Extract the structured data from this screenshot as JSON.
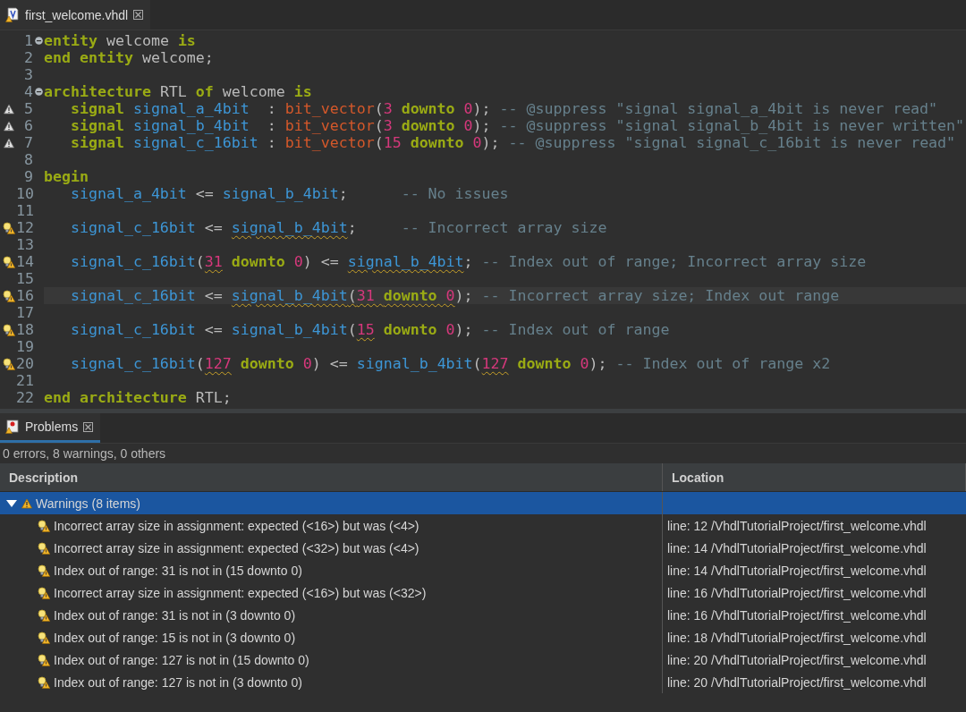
{
  "editor": {
    "tab": {
      "label": "first_welcome.vhdl",
      "selected": true
    },
    "lines": [
      {
        "n": "1",
        "fold": true,
        "tokens": [
          {
            "kind": "keyword",
            "t": "entity"
          },
          {
            "kind": "plain",
            "t": " welcome "
          },
          {
            "kind": "keyword",
            "t": "is"
          }
        ]
      },
      {
        "n": "2",
        "tokens": [
          {
            "kind": "keyword",
            "t": "end "
          },
          {
            "kind": "keyword",
            "t": "entity"
          },
          {
            "kind": "plain",
            "t": " welcome;"
          }
        ]
      },
      {
        "n": "3"
      },
      {
        "n": "4",
        "fold": true,
        "tokens": [
          {
            "kind": "keyword",
            "t": "architecture"
          },
          {
            "kind": "plain",
            "t": " RTL "
          },
          {
            "kind": "keyword",
            "t": "of"
          },
          {
            "kind": "plain",
            "t": " welcome "
          },
          {
            "kind": "keyword",
            "t": "is"
          }
        ]
      },
      {
        "n": "5",
        "marker": {
          "kind": "warning"
        },
        "tokens": [
          {
            "kind": "keyword",
            "t": "   signal "
          },
          {
            "kind": "signal",
            "t": "signal_a_4bit"
          },
          {
            "kind": "plain",
            "t": "  : "
          },
          {
            "kind": "type",
            "t": "bit_vector"
          },
          {
            "kind": "plain",
            "t": "("
          },
          {
            "kind": "number",
            "t": "3 "
          },
          {
            "kind": "keyword",
            "t": "downto "
          },
          {
            "kind": "number",
            "t": "0"
          },
          {
            "kind": "plain",
            "t": "); "
          },
          {
            "kind": "comment",
            "t": "-- @suppress \"signal signal_a_4bit is never read\""
          }
        ]
      },
      {
        "n": "6",
        "marker": {
          "kind": "warning"
        },
        "tokens": [
          {
            "kind": "keyword",
            "t": "   signal "
          },
          {
            "kind": "signal",
            "t": "signal_b_4bit"
          },
          {
            "kind": "plain",
            "t": "  : "
          },
          {
            "kind": "type",
            "t": "bit_vector"
          },
          {
            "kind": "plain",
            "t": "("
          },
          {
            "kind": "number",
            "t": "3 "
          },
          {
            "kind": "keyword",
            "t": "downto "
          },
          {
            "kind": "number",
            "t": "0"
          },
          {
            "kind": "plain",
            "t": "); "
          },
          {
            "kind": "comment",
            "t": "-- @suppress \"signal signal_b_4bit is never written\""
          }
        ]
      },
      {
        "n": "7",
        "marker": {
          "kind": "warning"
        },
        "tokens": [
          {
            "kind": "keyword",
            "t": "   signal "
          },
          {
            "kind": "signal",
            "t": "signal_c_16bit"
          },
          {
            "kind": "plain",
            "t": " : "
          },
          {
            "kind": "type",
            "t": "bit_vector"
          },
          {
            "kind": "plain",
            "t": "("
          },
          {
            "kind": "number",
            "t": "15 "
          },
          {
            "kind": "keyword",
            "t": "downto "
          },
          {
            "kind": "number",
            "t": "0"
          },
          {
            "kind": "plain",
            "t": "); "
          },
          {
            "kind": "comment",
            "t": "-- @suppress \"signal signal_c_16bit is never read\""
          }
        ]
      },
      {
        "n": "8"
      },
      {
        "n": "9",
        "tokens": [
          {
            "kind": "keyword",
            "t": "begin"
          }
        ]
      },
      {
        "n": "10",
        "tokens": [
          {
            "kind": "signal",
            "t": "   signal_a_4bit"
          },
          {
            "kind": "plain",
            "t": " <= "
          },
          {
            "kind": "signal",
            "t": "signal_b_4bit"
          },
          {
            "kind": "plain",
            "t": ";      "
          },
          {
            "kind": "comment",
            "t": "-- No issues"
          }
        ]
      },
      {
        "n": "11"
      },
      {
        "n": "12",
        "marker": {
          "kind": "quickfix"
        },
        "tokens": [
          {
            "kind": "signal",
            "t": "   signal_c_16bit"
          },
          {
            "kind": "plain",
            "t": " <= "
          },
          {
            "kind": "signal",
            "t": "signal_b_4bit",
            "flagged": true
          },
          {
            "kind": "plain",
            "t": ";     "
          },
          {
            "kind": "comment",
            "t": "-- Incorrect array size"
          }
        ]
      },
      {
        "n": "13"
      },
      {
        "n": "14",
        "marker": {
          "kind": "quickfix"
        },
        "tokens": [
          {
            "kind": "signal",
            "t": "   signal_c_16bit"
          },
          {
            "kind": "plain",
            "t": "("
          },
          {
            "kind": "number",
            "t": "31",
            "flagged": true
          },
          {
            "kind": "keyword",
            "t": " downto "
          },
          {
            "kind": "number",
            "t": "0"
          },
          {
            "kind": "plain",
            "t": ") <= "
          },
          {
            "kind": "signal",
            "t": "signal_b_4bit",
            "flagged": true
          },
          {
            "kind": "plain",
            "t": "; "
          },
          {
            "kind": "comment",
            "t": "-- Index out of range; Incorrect array size"
          }
        ]
      },
      {
        "n": "15"
      },
      {
        "n": "16",
        "marker": {
          "kind": "quickfix"
        },
        "current": true,
        "tokens": [
          {
            "kind": "signal",
            "t": "   signal_c_16bit"
          },
          {
            "kind": "plain",
            "t": " <= "
          },
          {
            "kind": "signal",
            "t": "signal_b_4bit",
            "flagged": true
          },
          {
            "kind": "plain",
            "t": "(",
            "flagged": true
          },
          {
            "kind": "number",
            "t": "31 ",
            "flagged": true
          },
          {
            "kind": "keyword",
            "t": "downto ",
            "flagged": true
          },
          {
            "kind": "number",
            "t": "0",
            "flagged": true
          },
          {
            "kind": "plain",
            "t": "); "
          },
          {
            "kind": "comment",
            "t": "-- Incorrect array size; Index out range"
          }
        ]
      },
      {
        "n": "17"
      },
      {
        "n": "18",
        "marker": {
          "kind": "quickfix"
        },
        "tokens": [
          {
            "kind": "signal",
            "t": "   signal_c_16bit"
          },
          {
            "kind": "plain",
            "t": " <= "
          },
          {
            "kind": "signal",
            "t": "signal_b_4bit"
          },
          {
            "kind": "plain",
            "t": "("
          },
          {
            "kind": "number",
            "t": "15",
            "flagged": true
          },
          {
            "kind": "keyword",
            "t": " downto "
          },
          {
            "kind": "number",
            "t": "0"
          },
          {
            "kind": "plain",
            "t": "); "
          },
          {
            "kind": "comment",
            "t": "-- Index out of range"
          }
        ]
      },
      {
        "n": "19"
      },
      {
        "n": "20",
        "marker": {
          "kind": "quickfix"
        },
        "tokens": [
          {
            "kind": "signal",
            "t": "   signal_c_16bit"
          },
          {
            "kind": "plain",
            "t": "("
          },
          {
            "kind": "number",
            "t": "127",
            "flagged": true
          },
          {
            "kind": "keyword",
            "t": " downto "
          },
          {
            "kind": "number",
            "t": "0"
          },
          {
            "kind": "plain",
            "t": ") <= "
          },
          {
            "kind": "signal",
            "t": "signal_b_4bit"
          },
          {
            "kind": "plain",
            "t": "("
          },
          {
            "kind": "number",
            "t": "127",
            "flagged": true
          },
          {
            "kind": "keyword",
            "t": " downto "
          },
          {
            "kind": "number",
            "t": "0"
          },
          {
            "kind": "plain",
            "t": "); "
          },
          {
            "kind": "comment",
            "t": "-- Index out of range x2"
          }
        ]
      },
      {
        "n": "21"
      },
      {
        "n": "22",
        "tokens": [
          {
            "kind": "keyword",
            "t": "end architecture"
          },
          {
            "kind": "plain",
            "t": " RTL;"
          }
        ]
      }
    ]
  },
  "problems": {
    "tab": {
      "label": "Problems",
      "selected": true
    },
    "summary": "0 errors, 8 warnings, 0 others",
    "columns": [
      "Description",
      "Location"
    ],
    "group": {
      "label": "Warnings (8 items)",
      "expanded": true,
      "selected": true
    },
    "rows": [
      {
        "description": "Incorrect array size in assignment: expected (<16>) but was (<4>)",
        "location": "line: 12 /VhdlTutorialProject/first_welcome.vhdl"
      },
      {
        "description": "Incorrect array size in assignment: expected (<32>) but was (<4>)",
        "location": "line: 14 /VhdlTutorialProject/first_welcome.vhdl"
      },
      {
        "description": "Index out of range: 31 is not in (15 downto 0)",
        "location": "line: 14 /VhdlTutorialProject/first_welcome.vhdl"
      },
      {
        "description": "Incorrect array size in assignment: expected (<16>) but was (<32>)",
        "location": "line: 16 /VhdlTutorialProject/first_welcome.vhdl"
      },
      {
        "description": "Index out of range: 31 is not in (3 downto 0)",
        "location": "line: 16 /VhdlTutorialProject/first_welcome.vhdl"
      },
      {
        "description": "Index out of range: 15 is not in (3 downto 0)",
        "location": "line: 18 /VhdlTutorialProject/first_welcome.vhdl"
      },
      {
        "description": "Index out of range: 127 is not in (15 downto 0)",
        "location": "line: 20 /VhdlTutorialProject/first_welcome.vhdl"
      },
      {
        "description": "Index out of range: 127 is not in (3 downto 0)",
        "location": "line: 20 /VhdlTutorialProject/first_welcome.vhdl"
      }
    ]
  }
}
